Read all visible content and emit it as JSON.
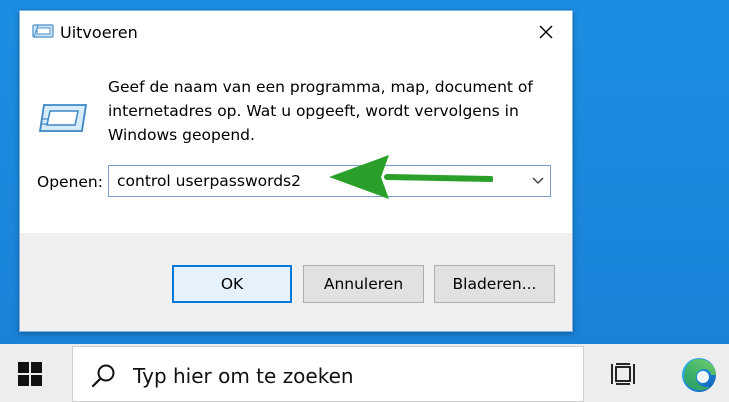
{
  "dialog": {
    "title": "Uitvoeren",
    "description": "Geef de naam van een programma, map, document of\ninternetadres op. Wat u opgeeft, wordt vervolgens in\nWindows geopend.",
    "open_label": "Openen:",
    "command_value": "control userpasswords2",
    "buttons": {
      "ok": "OK",
      "cancel": "Annuleren",
      "browse": "Bladeren..."
    }
  },
  "annotation": {
    "arrow_color": "#2aa02a"
  },
  "taskbar": {
    "search_placeholder": "Typ hier om te zoeken"
  },
  "colors": {
    "accent": "#0078d7",
    "desktop": "#1e8fe0"
  }
}
